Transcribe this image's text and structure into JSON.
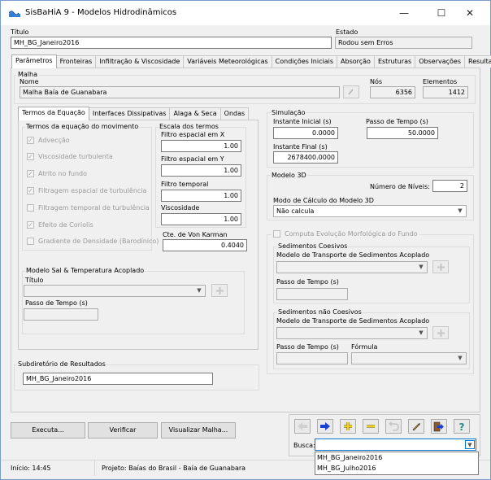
{
  "window": {
    "title": "SisBaHiA 9 - Modelos Hidrodinâmicos",
    "minimize": "—",
    "maximize": "☐",
    "close": "✕"
  },
  "header": {
    "titulo_label": "Título",
    "titulo_value": "MH_BG_Janeiro2016",
    "estado_label": "Estado",
    "estado_value": "Rodou sem Erros"
  },
  "tabs": [
    "Parâmetros",
    "Fronteiras",
    "Infiltração & Viscosidade",
    "Variáveis Meteorológicas",
    "Condições Iniciais",
    "Absorção",
    "Estruturas",
    "Observações",
    "Resultados"
  ],
  "malha": {
    "group_label": "Malha",
    "nome_label": "Nome",
    "nome_value": "Malha Baía de Guanabara",
    "nos_label": "Nós",
    "nos_value": "6356",
    "elementos_label": "Elementos",
    "elementos_value": "1412"
  },
  "subtabs": [
    "Termos da Equação",
    "Interfaces Dissipativas",
    "Alaga & Seca",
    "Ondas"
  ],
  "termos": {
    "group_label": "Termos da equação do movimento",
    "items": [
      "Advecção",
      "Viscosidade turbulenta",
      "Atrito no fundo",
      "Filtragem espacial de turbulência",
      "Filtragem temporal de turbulência",
      "Efeito de Coriolis",
      "Gradiente de Densidade (Barodínico)"
    ],
    "checked": [
      true,
      true,
      true,
      true,
      false,
      true,
      false
    ]
  },
  "escala": {
    "group_label": "Escala dos termos",
    "fx_label": "Filtro espacial em X",
    "fx_value": "1.00",
    "fy_label": "Filtro espacial em Y",
    "fy_value": "1.00",
    "ft_label": "Filtro temporal",
    "ft_value": "1.00",
    "visc_label": "Viscosidade",
    "visc_value": "1.00"
  },
  "karman": {
    "label": "Cte. de Von Karman",
    "value": "0.4040"
  },
  "sal": {
    "group_label": "Modelo Sal & Temperatura Acoplado",
    "titulo_label": "Título",
    "passo_label": "Passo de Tempo (s)"
  },
  "simulacao": {
    "group_label": "Simulação",
    "inicial_label": "Instante Inicial (s)",
    "inicial_value": "0.0000",
    "passo_label": "Passo de Tempo (s)",
    "passo_value": "50.0000",
    "final_label": "Instante Final (s)",
    "final_value": "2678400.0000"
  },
  "modelo3d": {
    "group_label": "Modelo 3D",
    "niveis_label": "Número de Níveis:",
    "niveis_value": "2",
    "modo_label": "Modo de Cálculo do Modelo 3D",
    "modo_value": "Não calcula"
  },
  "morfo": {
    "check_label": "Computa Evolução Morfológica do Fundo",
    "coesivos": {
      "group_label": "Sedimentos Coesivos",
      "modelo_label": "Modelo de Transporte de Sedimentos Acoplado",
      "passo_label": "Passo de Tempo (s)"
    },
    "nao_coesivos": {
      "group_label": "Sedimentos não Coesivos",
      "modelo_label": "Modelo de Transporte de Sedimentos Acoplado",
      "passo_label": "Passo de Tempo (s)",
      "formula_label": "Fórmula"
    }
  },
  "subdir": {
    "group_label": "Subdiretório de Resultados",
    "value": "MH_BG_Janeiro2016"
  },
  "buttons": {
    "executa": "Executa...",
    "verificar": "Verificar",
    "visualizar": "Visualizar Malha..."
  },
  "busca": {
    "label": "Busca:",
    "value": "",
    "options": [
      "MH_BG_Janeiro2016",
      "MH_BG_Julho2016"
    ]
  },
  "status": {
    "inicio": "Início: 14:45",
    "projeto": "Projeto: Baías do Brasil - Baía de Guanabara"
  },
  "colors": {
    "arrow_blue": "#1a3fd0",
    "plus_yellow": "#f2d11b",
    "help_teal": "#2a8a8a"
  }
}
